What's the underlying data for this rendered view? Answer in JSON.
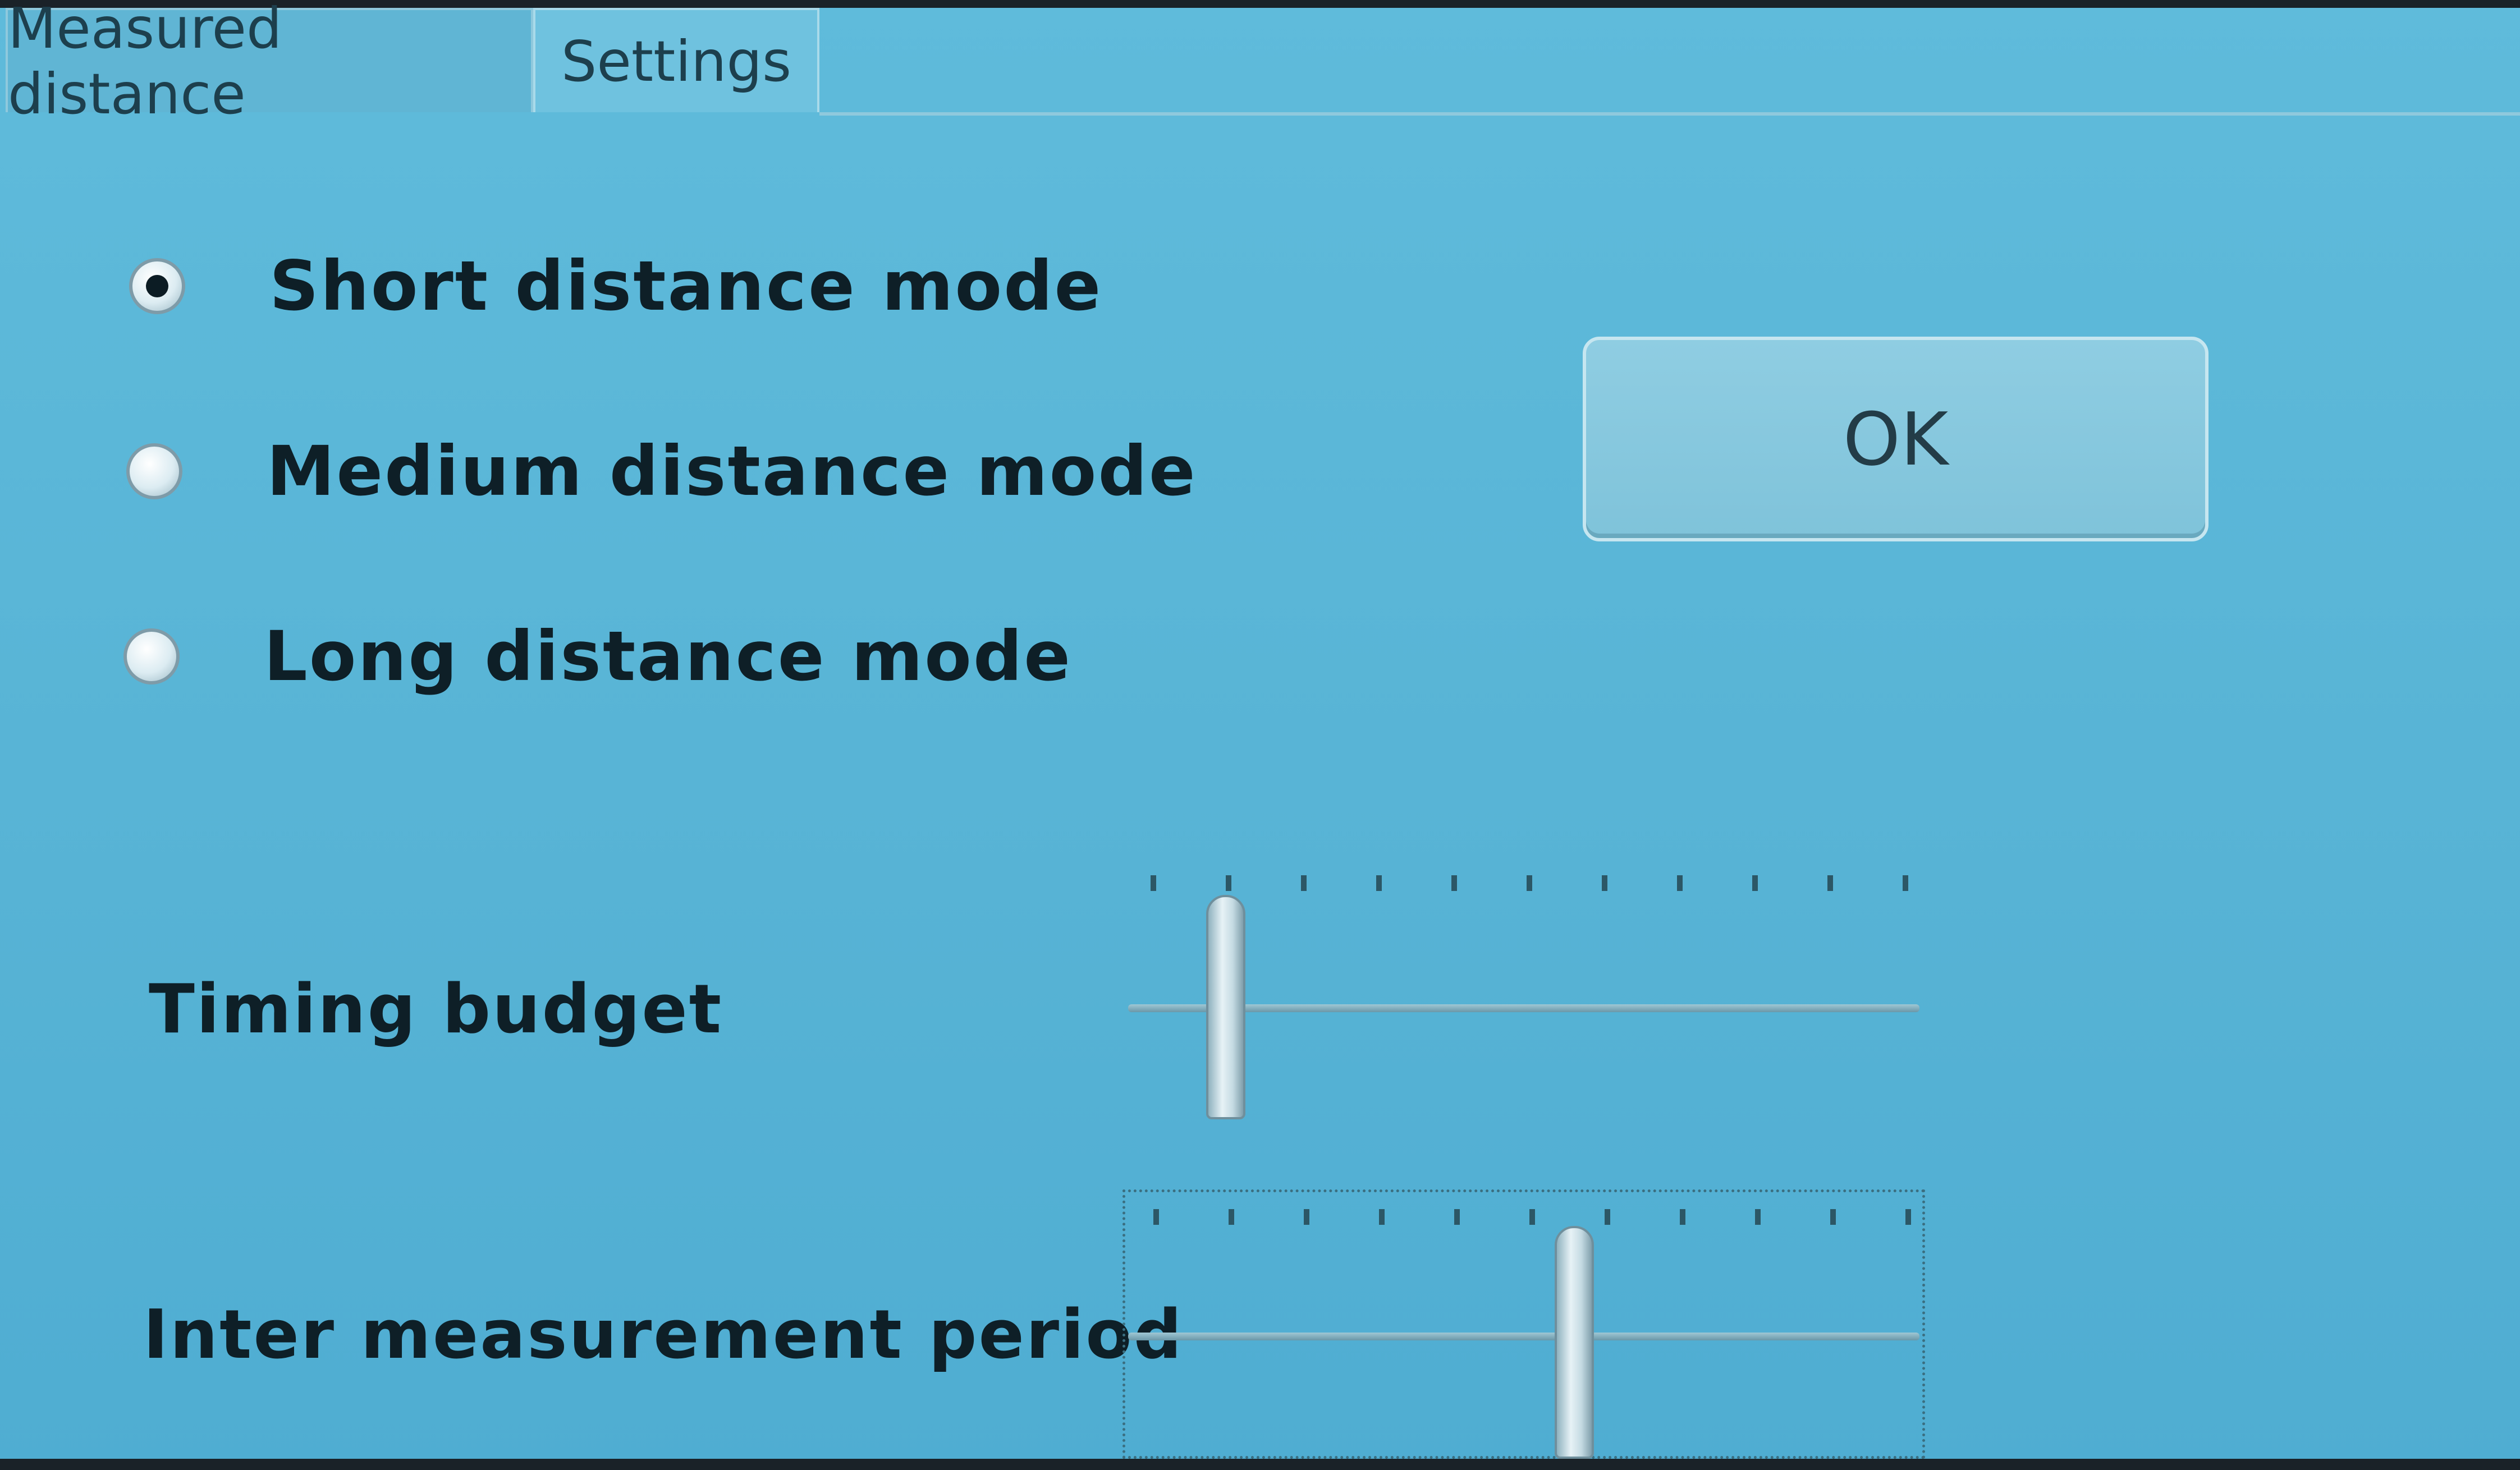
{
  "tabs": [
    {
      "label": "Measured distance",
      "active": false
    },
    {
      "label": "Settings",
      "active": true
    }
  ],
  "modes": {
    "selected": "short",
    "options": [
      {
        "id": "short",
        "label": "Short distance mode"
      },
      {
        "id": "medium",
        "label": "Medium distance mode"
      },
      {
        "id": "long",
        "label": "Long distance mode"
      }
    ]
  },
  "ok_button": {
    "label": "OK"
  },
  "timing_budget": {
    "label": "Timing budget",
    "tick_count": 11,
    "position_fraction": 0.1
  },
  "inter_measurement_period": {
    "label": "Inter measurement period",
    "tick_count": 11,
    "position_fraction": 0.56,
    "focused": true
  },
  "colors": {
    "background": "#5cb6d6",
    "text": "#0e1f27"
  }
}
